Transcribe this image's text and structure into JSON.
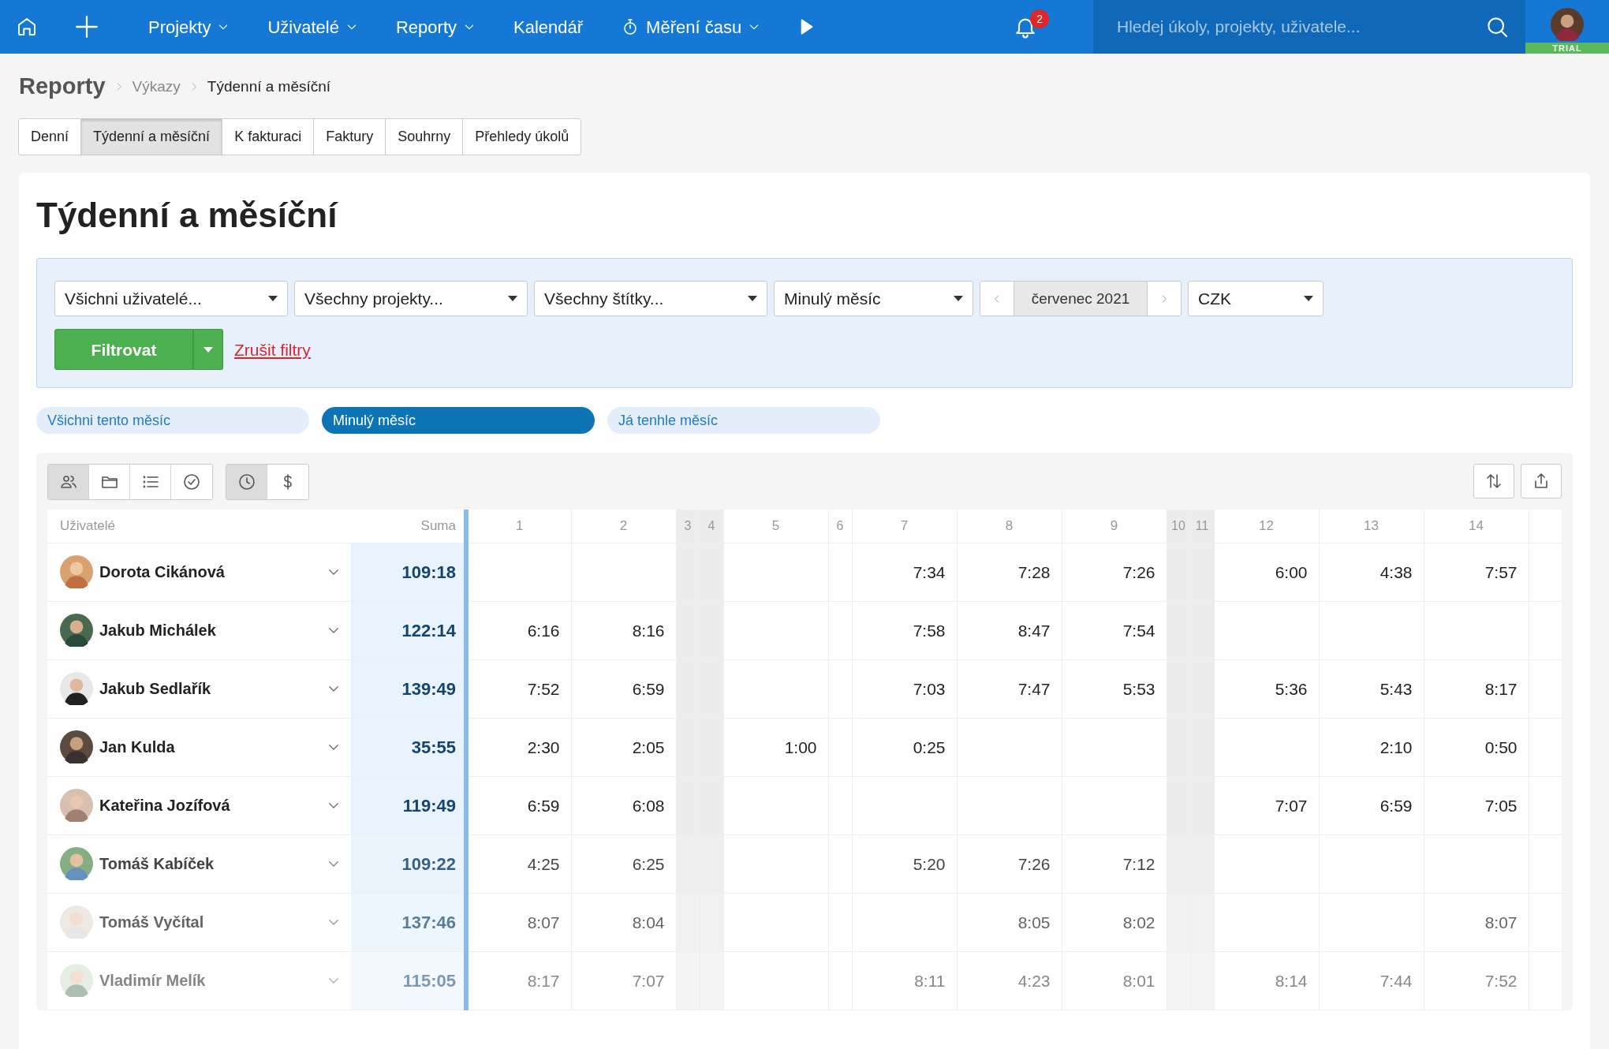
{
  "navbar": {
    "menu": [
      {
        "label": "Projekty",
        "kind": "link",
        "dropdown": true
      },
      {
        "label": "Uživatelé",
        "kind": "link",
        "dropdown": true
      },
      {
        "label": "Reporty",
        "kind": "link",
        "dropdown": true
      },
      {
        "label": "Kalendář",
        "kind": "link",
        "dropdown": false
      },
      {
        "label": "Měření času",
        "kind": "timer",
        "dropdown": true
      }
    ],
    "notifications": {
      "count": "2"
    },
    "search": {
      "placeholder": "Hledej úkoly, projekty, uživatele..."
    },
    "account": {
      "badge": "TRIAL"
    }
  },
  "breadcrumb": [
    "Reporty",
    "Výkazy",
    "Týdenní a měsíční"
  ],
  "tabs": [
    {
      "label": "Denní",
      "selected": false
    },
    {
      "label": "Týdenní a měsíční",
      "selected": true
    },
    {
      "label": "K fakturaci",
      "selected": false
    },
    {
      "label": "Faktury",
      "selected": false
    },
    {
      "label": "Souhrny",
      "selected": false
    },
    {
      "label": "Přehledy úkolů",
      "selected": false
    }
  ],
  "title": "Týdenní a měsíční",
  "filters": {
    "selects": [
      {
        "value": "Všichni uživatelé..."
      },
      {
        "value": "Všechny projekty..."
      },
      {
        "value": "Všechny štítky..."
      },
      {
        "value": "Minulý měsíc"
      }
    ],
    "period": {
      "value": "červenec 2021"
    },
    "currency": {
      "value": "CZK"
    },
    "filter_button": "Filtrovat",
    "clear_link": "Zrušit filtry"
  },
  "presets": [
    {
      "label": "Všichni tento měsíc",
      "selected": false
    },
    {
      "label": "Minulý měsíc",
      "selected": true
    },
    {
      "label": "Já tenhle měsíc",
      "selected": false
    }
  ],
  "view_buttons": [
    [
      {
        "selected": true
      },
      {
        "selected": false
      },
      {
        "selected": false
      },
      {
        "selected": false
      }
    ],
    [
      {
        "selected": true
      },
      {
        "selected": false
      }
    ]
  ],
  "table": {
    "columns": {
      "user": "Uživatelé",
      "sum": "Suma"
    },
    "days": [
      {
        "label": "1",
        "kind": "workday"
      },
      {
        "label": "2",
        "kind": "workday"
      },
      {
        "label": "3",
        "kind": "weekend"
      },
      {
        "label": "4",
        "kind": "weekend"
      },
      {
        "label": "5",
        "kind": "workday"
      },
      {
        "label": "6",
        "kind": "holiday"
      },
      {
        "label": "7",
        "kind": "workday"
      },
      {
        "label": "8",
        "kind": "workday"
      },
      {
        "label": "9",
        "kind": "workday"
      },
      {
        "label": "10",
        "kind": "weekend"
      },
      {
        "label": "11",
        "kind": "weekend"
      },
      {
        "label": "12",
        "kind": "workday"
      },
      {
        "label": "13",
        "kind": "workday"
      },
      {
        "label": "14",
        "kind": "workday"
      }
    ],
    "rows": [
      {
        "name": "Dorota Cikánová",
        "sum": "109:18",
        "values": {
          "7": "7:34",
          "8": "7:28",
          "9": "7:26",
          "12": "6:00",
          "13": "4:38",
          "14": "7:57"
        }
      },
      {
        "name": "Jakub Michálek",
        "sum": "122:14",
        "values": {
          "1": "6:16",
          "2": "8:16",
          "7": "7:58",
          "8": "8:47",
          "9": "7:54"
        }
      },
      {
        "name": "Jakub Sedlařík",
        "sum": "139:49",
        "values": {
          "1": "7:52",
          "2": "6:59",
          "7": "7:03",
          "8": "7:47",
          "9": "5:53",
          "12": "5:36",
          "13": "5:43",
          "14": "8:17"
        }
      },
      {
        "name": "Jan Kulda",
        "sum": "35:55",
        "values": {
          "1": "2:30",
          "2": "2:05",
          "5": "1:00",
          "7": "0:25",
          "13": "2:10",
          "14": "0:50"
        }
      },
      {
        "name": "Kateřina Jozífová",
        "sum": "119:49",
        "values": {
          "1": "6:59",
          "2": "6:08",
          "12": "7:07",
          "13": "6:59",
          "14": "7:05"
        }
      },
      {
        "name": "Tomáš Kabíček",
        "sum": "109:22",
        "values": {
          "1": "4:25",
          "2": "6:25",
          "7": "5:20",
          "8": "7:26",
          "9": "7:12"
        }
      },
      {
        "name": "Tomáš Vyčítal",
        "sum": "137:46",
        "values": {
          "1": "8:07",
          "2": "8:04",
          "8": "8:05",
          "9": "8:02",
          "14": "8:07"
        }
      },
      {
        "name": "Vladimír Melík",
        "sum": "115:05",
        "values": {
          "1": "8:17",
          "2": "7:07",
          "7": "8:11",
          "8": "4:23",
          "9": "8:01",
          "12": "8:14",
          "13": "7:44",
          "14": "7:52"
        }
      }
    ]
  }
}
